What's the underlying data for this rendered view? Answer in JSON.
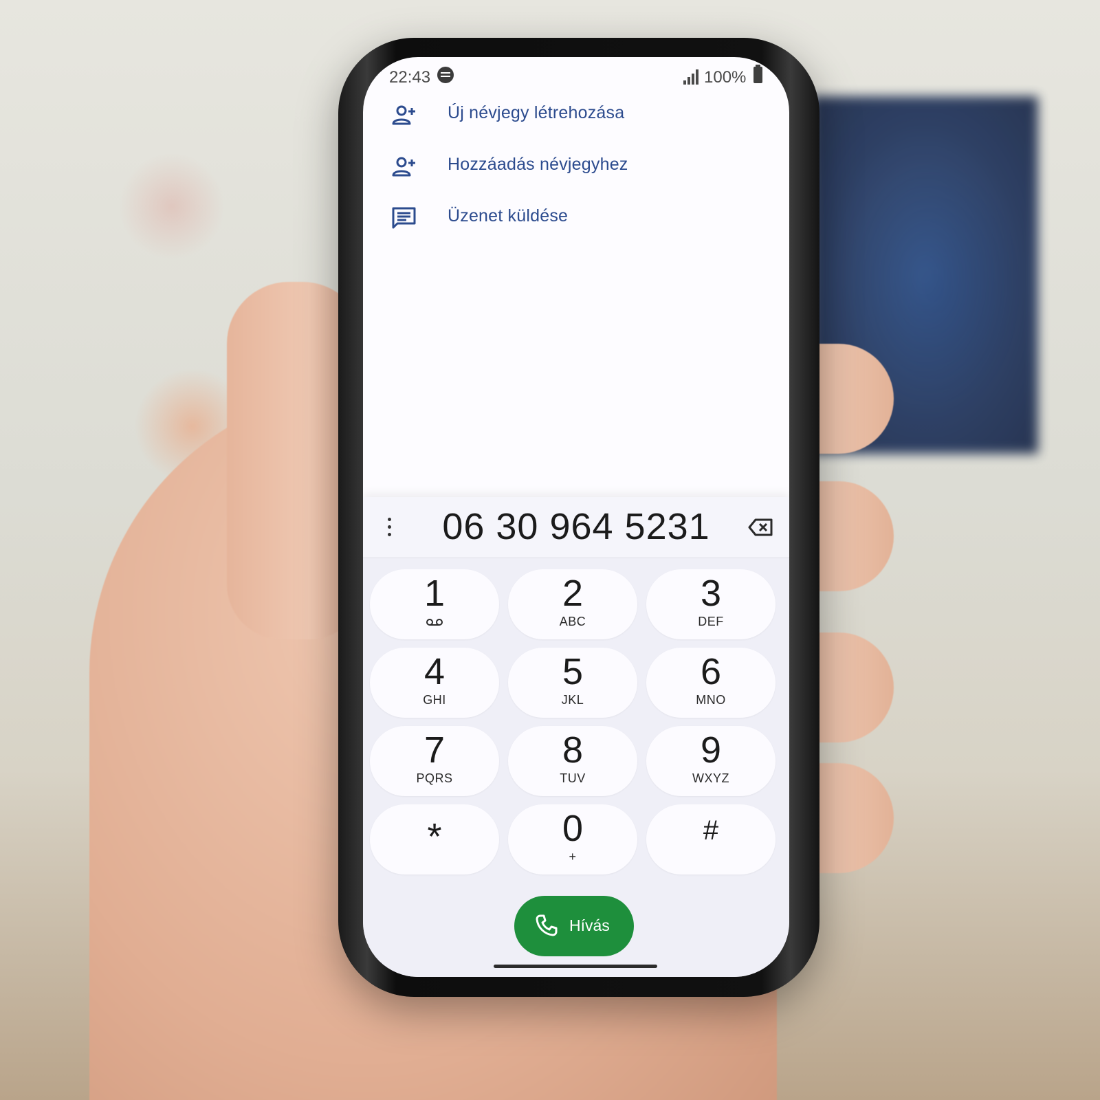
{
  "status_bar": {
    "time": "22:43",
    "app_icon": "spotify-icon",
    "signal_icon": "cellular-signal-icon",
    "battery_percent": "100%",
    "battery_icon": "battery-full-icon"
  },
  "menu": {
    "items": [
      {
        "label": "Új névjegy létrehozása",
        "icon": "person-add-icon"
      },
      {
        "label": "Hozzáadás névjegyhez",
        "icon": "person-add-icon"
      },
      {
        "label": "Üzenet küldése",
        "icon": "message-icon"
      }
    ]
  },
  "dialer": {
    "number": "06 30 964 5231",
    "more_icon": "more-vert-icon",
    "backspace_icon": "backspace-icon",
    "keys": [
      {
        "digit": "1",
        "letters": "",
        "sub_icon": "voicemail-icon"
      },
      {
        "digit": "2",
        "letters": "ABC"
      },
      {
        "digit": "3",
        "letters": "DEF"
      },
      {
        "digit": "4",
        "letters": "GHI"
      },
      {
        "digit": "5",
        "letters": "JKL"
      },
      {
        "digit": "6",
        "letters": "MNO"
      },
      {
        "digit": "7",
        "letters": "PQRS"
      },
      {
        "digit": "8",
        "letters": "TUV"
      },
      {
        "digit": "9",
        "letters": "WXYZ"
      },
      {
        "digit": "*",
        "letters": ""
      },
      {
        "digit": "0",
        "letters": "+"
      },
      {
        "digit": "#",
        "letters": ""
      }
    ],
    "call_button": {
      "label": "Hívás",
      "icon": "phone-icon"
    }
  },
  "colors": {
    "accent_text": "#2c4b8e",
    "call_green": "#1e8f3c",
    "keypad_bg": "#efeff7",
    "key_bg": "#fcfbff"
  }
}
